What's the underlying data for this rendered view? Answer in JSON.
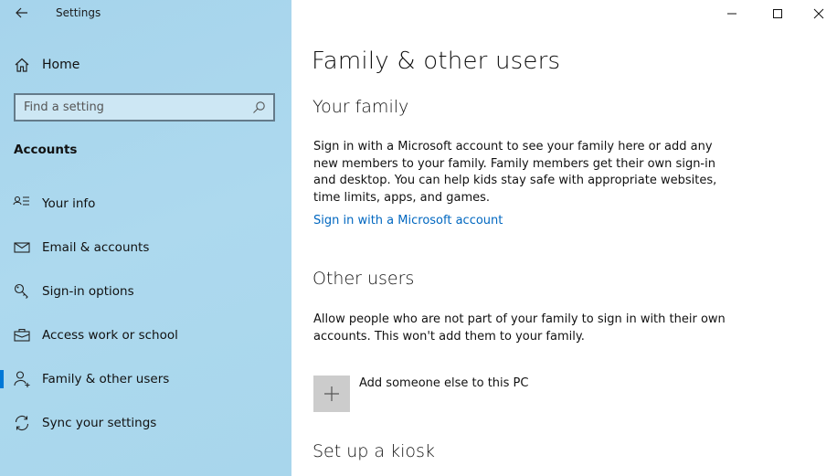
{
  "window": {
    "title": "Settings",
    "controls": {
      "minimize": "minimize-icon",
      "maximize": "maximize-icon",
      "close": "close-icon"
    }
  },
  "colors": {
    "accent": "#0078d7",
    "link": "#0067c0",
    "sidebar_bg": "#a9d6ec",
    "search_bg": "#cde7f4",
    "tile_bg": "#cccccc"
  },
  "sidebar": {
    "home_label": "Home",
    "search_placeholder": "Find a setting",
    "search_value": "",
    "section_title": "Accounts",
    "items": [
      {
        "label": "Your info",
        "icon": "contact-info-icon",
        "selected": false
      },
      {
        "label": "Email & accounts",
        "icon": "mail-icon",
        "selected": false
      },
      {
        "label": "Sign-in options",
        "icon": "key-icon",
        "selected": false
      },
      {
        "label": "Access work or school",
        "icon": "briefcase-icon",
        "selected": false
      },
      {
        "label": "Family & other users",
        "icon": "add-person-icon",
        "selected": true
      },
      {
        "label": "Sync your settings",
        "icon": "sync-icon",
        "selected": false
      }
    ]
  },
  "main": {
    "title": "Family & other users",
    "your_family": {
      "heading": "Your family",
      "description": "Sign in with a Microsoft account to see your family here or add any new members to your family. Family members get their own sign-in and desktop. You can help kids stay safe with appropriate websites, time limits, apps, and games.",
      "link": "Sign in with a Microsoft account"
    },
    "other_users": {
      "heading": "Other users",
      "description": "Allow people who are not part of your family to sign in with their own accounts. This won't add them to your family.",
      "add_label": "Add someone else to this PC"
    },
    "kiosk": {
      "heading": "Set up a kiosk"
    }
  }
}
